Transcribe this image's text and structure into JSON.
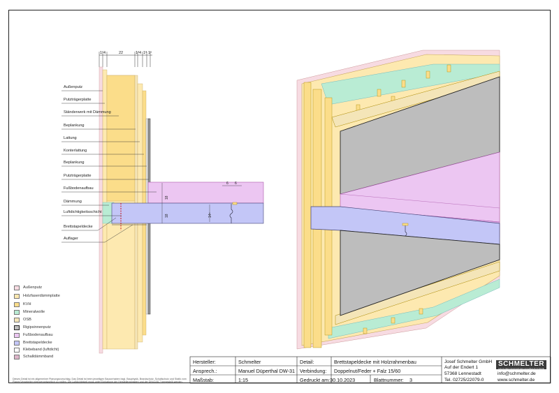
{
  "dimensions": {
    "top": [
      "1⁷",
      "4",
      "22",
      "1⁴",
      "4",
      "1⁸",
      "1⁵"
    ],
    "slab_height_1": "18",
    "slab_height_2": "18",
    "slab_height_3": "14⁵",
    "dim_small_1": "6",
    "dim_small_2": "6"
  },
  "callouts": [
    "Außenputz",
    "Putzträgerplatte",
    "Ständerwerk mit Dämmung",
    "Beplankung",
    "Lattung",
    "Konterlattung",
    "Beplankung",
    "Putzträgerplatte",
    "Fußbodenaufbau",
    "Dämmung",
    "Luftdichtigkeitsschicht",
    "Brettstapeldecke",
    "Auflager"
  ],
  "legend": [
    {
      "label": "Außenputz",
      "color": "#f7dbe2"
    },
    {
      "label": "Holzfaserdämmplatte",
      "color": "#fde9b0"
    },
    {
      "label": "KVH",
      "color": "#fbdd8a"
    },
    {
      "label": "Mineralwolle",
      "color": "#b9ecd4"
    },
    {
      "label": "OSB",
      "color": "#f4e5b8"
    },
    {
      "label": "Rigipsinnenputz",
      "color": "#bdbdbd"
    },
    {
      "label": "Fußbodenaufbau",
      "color": "#ecc6f2"
    },
    {
      "label": "Brettstapeldecke",
      "color": "#c3c6f7"
    },
    {
      "label": "Klebeband (luftdicht)",
      "color": "#ffffff"
    },
    {
      "label": "Schalldämmband",
      "color": "#dcb4c8"
    }
  ],
  "title_block": {
    "hersteller_label": "Hersteller:",
    "hersteller": "Schmelter",
    "ansprech_label": "Ansprech.:",
    "ansprech": "Manuel Düperthal DW-31",
    "massstab_label": "Maßstab:",
    "massstab": "1:15",
    "detail_label": "Detail:",
    "detail": "Brettstapeldecke mit Holzrahmenbau",
    "verbindung_label": "Verbindung:",
    "verbindung": "Doppelnut/Feder + Falz 15/60",
    "gedruckt": "Gedruckt am:30.10.2023",
    "blatt_label": "Blattnummer:",
    "blatt": "3",
    "company": "Josef Schmelter GmbH",
    "street": "Auf der Endert 1",
    "city": "57368 Lennestadt",
    "tel": "Tel. 02725/22079-0",
    "email": "info@schmelter.de",
    "web": "www.schmelter.de",
    "logo": "SCHMELTER",
    "logo_sub": "HAUS DER INNOVATIVEN HOLZBAUSYSTEME"
  },
  "note": "Dieses Detail ist ein allgemeiner Planungsvorschlag. Das Detail ist beim jeweiligen Bauvorhaben bzgl. Bauphysik, Brandschutz, Schallschutz und Statik vom Planer/Verarbeiter eigenverantwortlich zu prüfen. Die Luftdichtigkeit muss unter Einhaltung der Herstellerangaben und der DIN4108-7 hergestellt werden."
}
